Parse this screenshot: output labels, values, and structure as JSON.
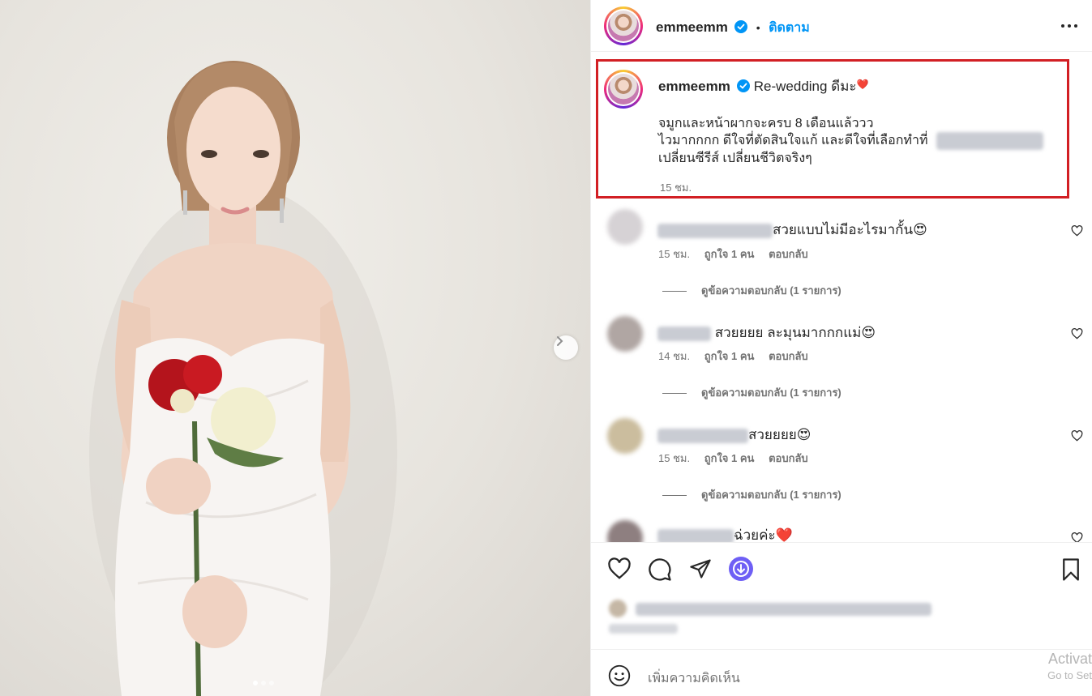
{
  "post": {
    "username": "emmeemm",
    "separator": "•",
    "follow_label": "ติดตาม",
    "more_icon": "more-horizontal-icon",
    "verified_icon": "verified-badge-icon"
  },
  "photo": {
    "next_icon": "chevron-right-icon",
    "carousel_dots": 3,
    "active_dot": 1
  },
  "caption": {
    "username": "emmeemm",
    "title": "Re-wedding ดีมะ",
    "title_emoji": "❤️",
    "line1": "จมูกและหน้าผากจะครบ 8 เดือนแล้ววว",
    "line2": "ไวมากกกก ดีใจที่ตัดสินใจแก้ และดีใจที่เลือกทำที่",
    "line3": "เปลี่ยนซีรีส์ เปลี่ยนชีวิตจริงๆ",
    "time": "15 ชม."
  },
  "comments": [
    {
      "text": "สวยแบบไม่มีอะไรมากั้น😍",
      "time": "15 ชม.",
      "likes": "ถูกใจ 1 คน",
      "reply": "ตอบกลับ",
      "view_replies": "ดูข้อความตอบกลับ (1 รายการ)"
    },
    {
      "text": "สวยยยย ละมุนมากกกแม่😍",
      "time": "14 ชม.",
      "likes": "ถูกใจ 1 คน",
      "reply": "ตอบกลับ",
      "view_replies": "ดูข้อความตอบกลับ (1 รายการ)"
    },
    {
      "text": "สวยยยย😍",
      "time": "15 ชม.",
      "likes": "ถูกใจ 1 คน",
      "reply": "ตอบกลับ",
      "view_replies": "ดูข้อความตอบกลับ (1 รายการ)"
    },
    {
      "text": "ฉ่วยค่ะ❤️"
    }
  ],
  "actions": {
    "like_icon": "heart-icon",
    "comment_icon": "comment-icon",
    "share_icon": "send-icon",
    "download_icon": "download-icon",
    "save_icon": "bookmark-icon"
  },
  "add_comment": {
    "emoji_icon": "emoji-icon",
    "placeholder": "เพิ่มความคิดเห็น"
  },
  "watermark": {
    "line1": "Activat",
    "line2": "Go to Set"
  },
  "colors": {
    "accent": "#0095f6",
    "highlight_border": "#d21f24",
    "verified": "#0095f6",
    "download": "#6e5ff5"
  }
}
